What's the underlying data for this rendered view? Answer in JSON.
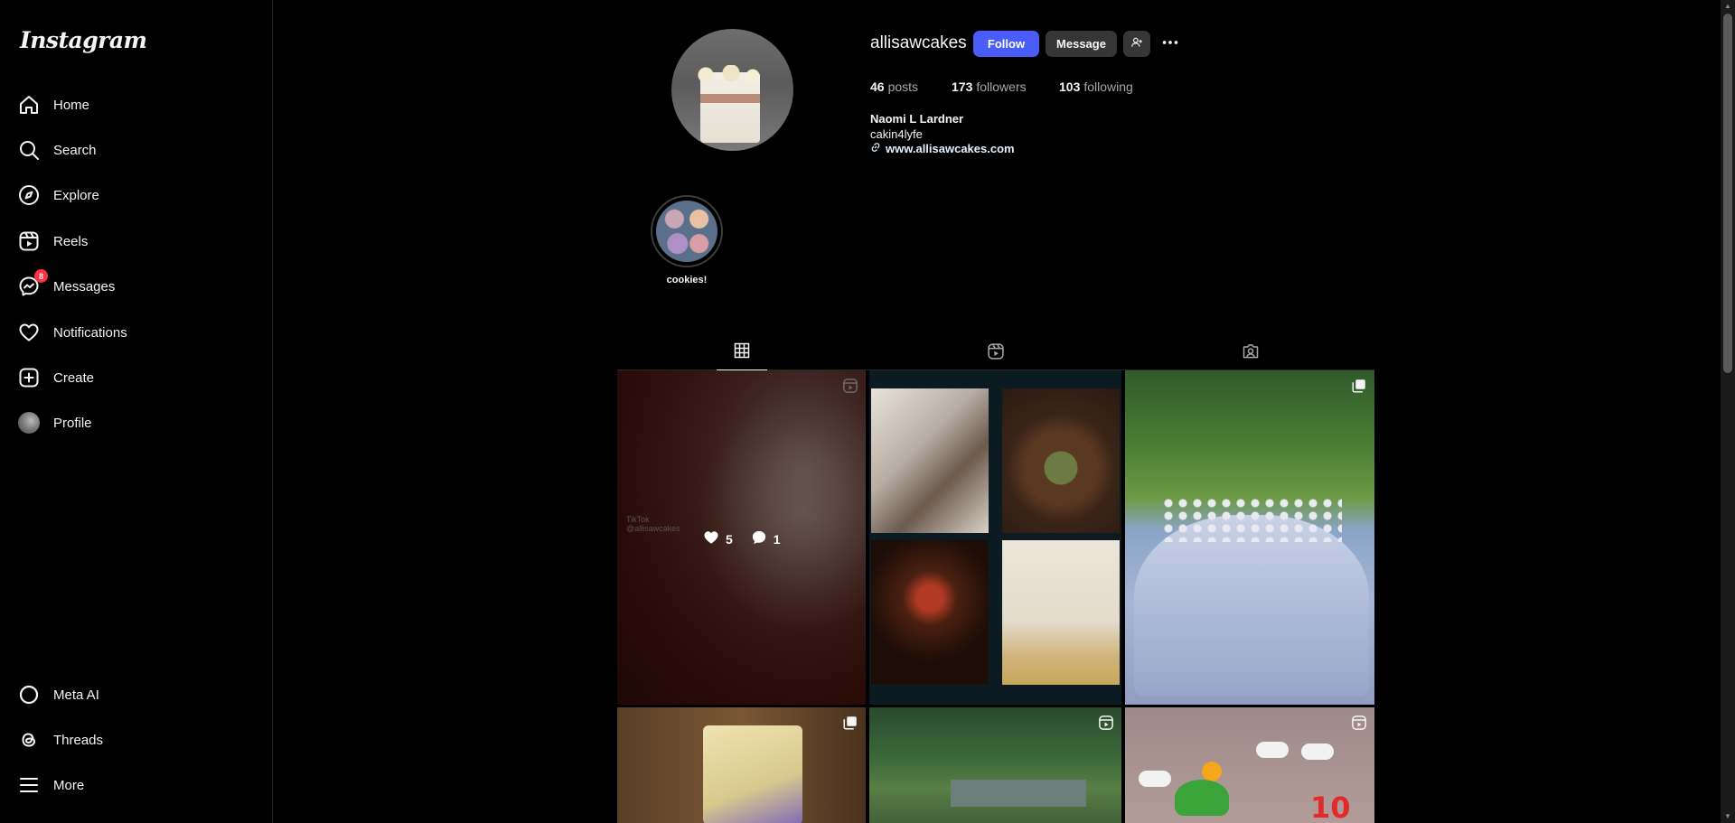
{
  "app": {
    "logo": "Instagram"
  },
  "sidebar": {
    "items": [
      {
        "label": "Home",
        "icon": "home-icon"
      },
      {
        "label": "Search",
        "icon": "search-icon"
      },
      {
        "label": "Explore",
        "icon": "compass-icon"
      },
      {
        "label": "Reels",
        "icon": "reels-icon"
      },
      {
        "label": "Messages",
        "icon": "messenger-icon",
        "badge": "8"
      },
      {
        "label": "Notifications",
        "icon": "heart-icon"
      },
      {
        "label": "Create",
        "icon": "plus-square-icon"
      },
      {
        "label": "Profile",
        "icon": "avatar"
      }
    ],
    "bottom": [
      {
        "label": "Meta AI",
        "icon": "meta-ai-icon"
      },
      {
        "label": "Threads",
        "icon": "threads-icon"
      },
      {
        "label": "More",
        "icon": "menu-icon"
      }
    ]
  },
  "profile": {
    "username": "allisawcakes",
    "follow_label": "Follow",
    "message_label": "Message",
    "stats": {
      "posts_count": "46",
      "posts_label": "posts",
      "followers_count": "173",
      "followers_label": "followers",
      "following_count": "103",
      "following_label": "following"
    },
    "full_name": "Naomi L Lardner",
    "bio": "cakin4lyfe",
    "link": "www.allisawcakes.com"
  },
  "highlights": [
    {
      "label": "cookies!"
    }
  ],
  "tabs": [
    {
      "name": "posts",
      "icon": "grid-icon",
      "active": true
    },
    {
      "name": "reels",
      "icon": "reels-icon",
      "active": false
    },
    {
      "name": "tagged",
      "icon": "tagged-icon",
      "active": false
    }
  ],
  "posts": [
    {
      "type": "reel",
      "likes": "5",
      "comments": "1",
      "watermark": "TikTok",
      "watermark_handle": "@allisawcakes"
    },
    {
      "type": "carousel"
    },
    {
      "type": "carousel"
    },
    {
      "type": "carousel"
    },
    {
      "type": "reel"
    },
    {
      "type": "reel",
      "text": "10"
    }
  ],
  "colors": {
    "accent": "#4a5df9",
    "badge": "#ff3040",
    "background": "#000000",
    "secondary_button": "#363636"
  }
}
